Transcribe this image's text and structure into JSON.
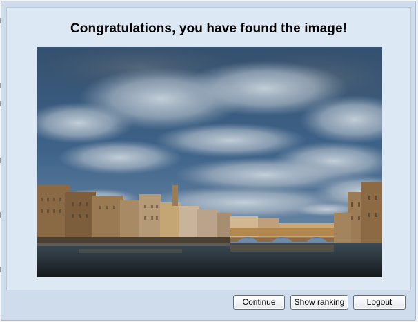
{
  "dialog": {
    "title": "Congratulations, you have found the image!"
  },
  "image": {
    "subject": "river-bridge-city-photo"
  },
  "buttons": {
    "continue_label": "Continue",
    "ranking_label": "Show ranking",
    "logout_label": "Logout"
  },
  "colors": {
    "dialog_background": "#cfdcec",
    "panel_background": "#dde8f5",
    "button_border": "#5b6b80"
  }
}
